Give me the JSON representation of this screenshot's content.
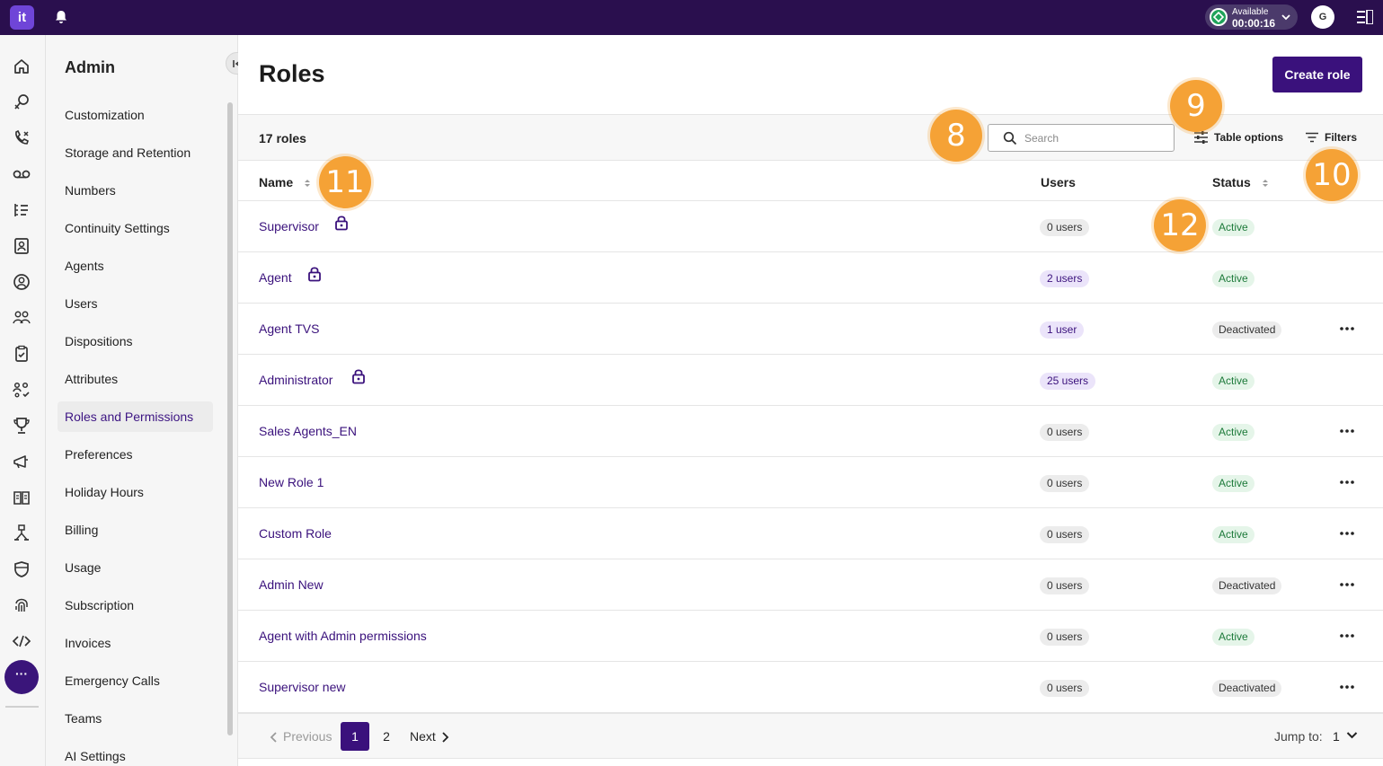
{
  "topbar": {
    "logo": "it",
    "status_label": "Available",
    "status_time": "00:00:16",
    "avatar_initial": "G"
  },
  "sidebar": {
    "title": "Admin",
    "items": [
      {
        "label": "Customization"
      },
      {
        "label": "Storage and Retention"
      },
      {
        "label": "Numbers"
      },
      {
        "label": "Continuity Settings"
      },
      {
        "label": "Agents"
      },
      {
        "label": "Users"
      },
      {
        "label": "Dispositions"
      },
      {
        "label": "Attributes"
      },
      {
        "label": "Roles and Permissions"
      },
      {
        "label": "Preferences"
      },
      {
        "label": "Holiday Hours"
      },
      {
        "label": "Billing"
      },
      {
        "label": "Usage"
      },
      {
        "label": "Subscription"
      },
      {
        "label": "Invoices"
      },
      {
        "label": "Emergency Calls"
      },
      {
        "label": "Teams"
      },
      {
        "label": "AI Settings"
      }
    ],
    "active_item": "Roles and Permissions"
  },
  "rail": {
    "more_label": "···",
    "icons": [
      "home-icon",
      "voice-icon",
      "call-icon",
      "voicemail-icon",
      "list-icon",
      "contacts-icon",
      "user-circle-icon",
      "team-icon",
      "clipboard-icon",
      "org-icon",
      "trophy-icon",
      "campaign-icon",
      "book-icon",
      "flow-icon",
      "shield-icon",
      "fingerprint-icon",
      "code-icon"
    ]
  },
  "main": {
    "title": "Roles",
    "create_label": "Create role",
    "count_label": "17 roles",
    "search_placeholder": "Search",
    "table_options_label": "Table options",
    "filters_label": "Filters",
    "columns": {
      "name": "Name",
      "users": "Users",
      "status": "Status"
    },
    "rows": [
      {
        "name": "Supervisor",
        "locked": true,
        "users": "0 users",
        "users_zero": true,
        "status": "Active",
        "menu": false
      },
      {
        "name": "Agent",
        "locked": true,
        "users": "2 users",
        "users_zero": false,
        "status": "Active",
        "menu": false
      },
      {
        "name": "Agent TVS",
        "locked": false,
        "users": "1 user",
        "users_zero": false,
        "status": "Deactivated",
        "menu": true
      },
      {
        "name": "Administrator",
        "locked": true,
        "users": "25 users",
        "users_zero": false,
        "status": "Active",
        "menu": false
      },
      {
        "name": "Sales Agents_EN",
        "locked": false,
        "users": "0 users",
        "users_zero": true,
        "status": "Active",
        "menu": true
      },
      {
        "name": "New Role 1",
        "locked": false,
        "users": "0 users",
        "users_zero": true,
        "status": "Active",
        "menu": true
      },
      {
        "name": "Custom Role",
        "locked": false,
        "users": "0 users",
        "users_zero": true,
        "status": "Active",
        "menu": true
      },
      {
        "name": "Admin New",
        "locked": false,
        "users": "0 users",
        "users_zero": true,
        "status": "Deactivated",
        "menu": true
      },
      {
        "name": "Agent with Admin permissions",
        "locked": false,
        "users": "0 users",
        "users_zero": true,
        "status": "Active",
        "menu": true
      },
      {
        "name": "Supervisor new",
        "locked": false,
        "users": "0 users",
        "users_zero": true,
        "status": "Deactivated",
        "menu": true
      }
    ],
    "pagination": {
      "prev_label": "Previous",
      "pages": [
        "1",
        "2"
      ],
      "current": "1",
      "next_label": "Next",
      "jump_label": "Jump to:",
      "jump_value": "1"
    }
  },
  "callouts": [
    {
      "label": "8"
    },
    {
      "label": "9"
    },
    {
      "label": "10"
    },
    {
      "label": "11"
    },
    {
      "label": "12"
    }
  ],
  "colors": {
    "brand": "#3a117c",
    "topbar": "#2a0f4e",
    "callout": "#f5a236",
    "active_status": "#1d7a3a"
  }
}
